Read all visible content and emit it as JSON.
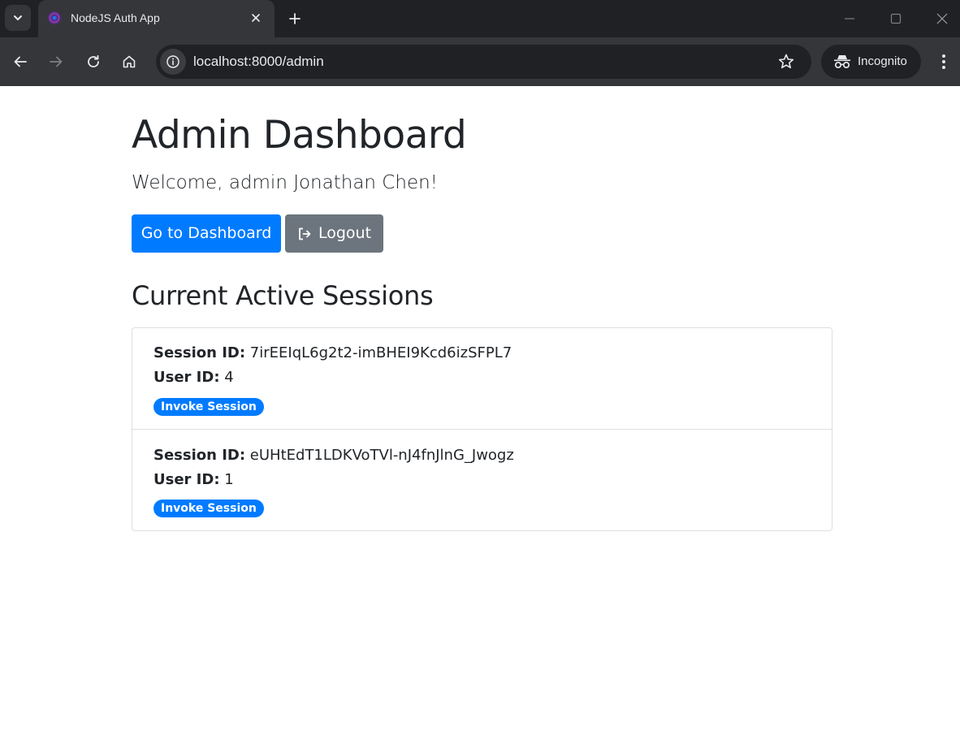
{
  "browser": {
    "tab_title": "NodeJS Auth App",
    "url": "localhost:8000/admin",
    "incognito_label": "Incognito"
  },
  "page": {
    "title": "Admin Dashboard",
    "welcome": "Welcome, admin Jonathan Chen!",
    "dashboard_button": "Go to Dashboard",
    "logout_button": "Logout",
    "sessions_heading": "Current Active Sessions"
  },
  "sessions": [
    {
      "session_label": "Session ID:",
      "session_id": "7irEEIqL6g2t2-imBHEI9Kcd6izSFPL7",
      "user_label": "User ID:",
      "user_id": "4",
      "action": "Invoke Session"
    },
    {
      "session_label": "Session ID:",
      "session_id": "eUHtEdT1LDKVoTVl-nJ4fnJlnG_Jwogz",
      "user_label": "User ID:",
      "user_id": "1",
      "action": "Invoke Session"
    }
  ],
  "colors": {
    "primary": "#007bff",
    "secondary": "#6c757d",
    "chrome_dark": "#202124",
    "chrome_toolbar": "#35363a"
  }
}
